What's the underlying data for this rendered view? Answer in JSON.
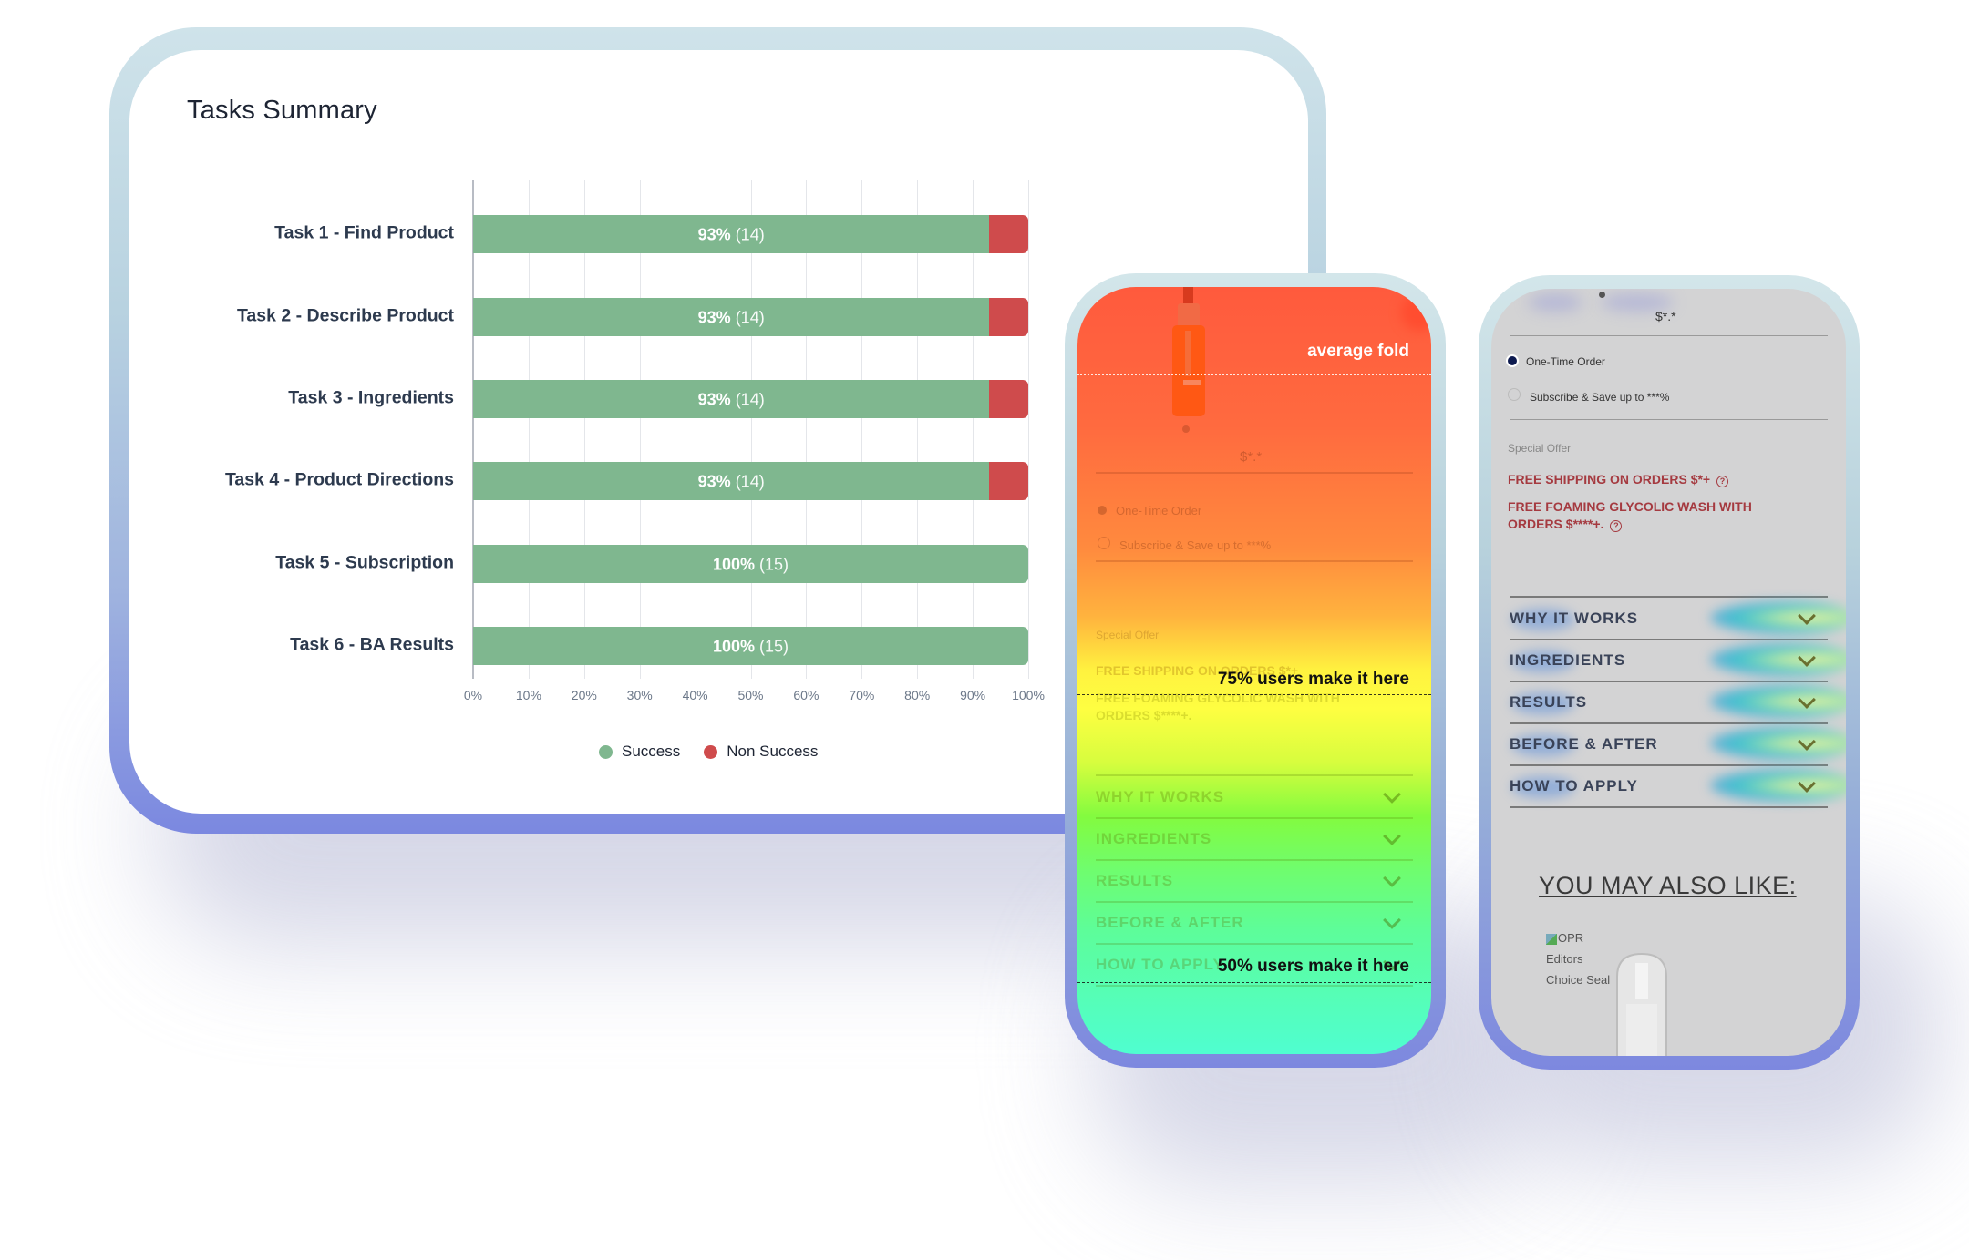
{
  "dashboard": {
    "title": "Tasks Summary",
    "legend": [
      {
        "label": "Success",
        "color": "#7fb78f"
      },
      {
        "label": "Non Success",
        "color": "#cf4b4c"
      }
    ]
  },
  "chart_data": {
    "type": "bar",
    "orientation": "horizontal",
    "stacked": true,
    "title": "Tasks Summary",
    "xlabel": "",
    "ylabel": "",
    "xlim": [
      0,
      100
    ],
    "x_ticks": [
      "0%",
      "10%",
      "20%",
      "30%",
      "40%",
      "50%",
      "60%",
      "70%",
      "80%",
      "90%",
      "100%"
    ],
    "x_ticks_visible": [
      "0%",
      "10%",
      "20%",
      "30%",
      "40%",
      "50%",
      "60%",
      "70%"
    ],
    "grid": true,
    "legend_position": "bottom-center",
    "categories": [
      "Task 1 - Find Product",
      "Task 2 - Describe Product",
      "Task 3 - Ingredients",
      "Task 4 - Product Directions",
      "Task 5 - Subscription",
      "Task 6 - BA Results"
    ],
    "series": [
      {
        "name": "Success",
        "color": "#7fb78f",
        "values": [
          93,
          93,
          93,
          93,
          100,
          100
        ],
        "counts": [
          14,
          14,
          14,
          14,
          15,
          15
        ]
      },
      {
        "name": "Non Success",
        "color": "#cf4b4c",
        "values": [
          7,
          7,
          7,
          7,
          0,
          0
        ],
        "counts": [
          1,
          1,
          1,
          1,
          0,
          0
        ]
      }
    ],
    "data_labels": [
      {
        "pct": "93%",
        "count": "(14)"
      },
      {
        "pct": "93%",
        "count": "(14)"
      },
      {
        "pct": "93%",
        "count": "(14)"
      },
      {
        "pct": "93%",
        "count": "(14)"
      },
      {
        "pct": "100%",
        "count": "(15)"
      },
      {
        "pct": "100%",
        "count": "(15)"
      }
    ]
  },
  "scroll_heatmap": {
    "fold_label": "average fold",
    "markers": [
      {
        "label": "75% users make it here",
        "percent": 75
      },
      {
        "label": "50% users make it here",
        "percent": 50
      }
    ],
    "price": "$*.*",
    "options": [
      "One-Time Order",
      "Subscribe & Save up to ***%"
    ],
    "special_offer_label": "Special Offer",
    "offers": [
      "FREE SHIPPING ON ORDERS $*+",
      "FREE FOAMING GLYCOLIC WASH WITH",
      "ORDERS $****+."
    ],
    "accordion": [
      "WHY IT WORKS",
      "INGREDIENTS",
      "RESULTS",
      "BEFORE & AFTER",
      "HOW TO APPLY"
    ],
    "colors": {
      "hot": "#ff5a3d",
      "warm": "#ffb33e",
      "mid": "#fefe41",
      "cool": "#83fb3f",
      "cold": "#4ffed0"
    }
  },
  "click_heatmap": {
    "price": "$*.*",
    "options": [
      "One-Time Order",
      "Subscribe & Save up to ***%"
    ],
    "selected_option": "One-Time Order",
    "special_offer_label": "Special Offer",
    "offers": [
      "FREE SHIPPING ON ORDERS $*+",
      "FREE FOAMING GLYCOLIC WASH WITH",
      "ORDERS $****+."
    ],
    "accordion": [
      "WHY IT WORKS",
      "INGREDIENTS",
      "RESULTS",
      "BEFORE & AFTER",
      "HOW TO APPLY"
    ],
    "recommend_heading": "YOU MAY ALSO LIKE:",
    "seal_alt": [
      "OPR",
      "Editors",
      "Choice Seal"
    ],
    "offer_color": "#a53a40"
  }
}
